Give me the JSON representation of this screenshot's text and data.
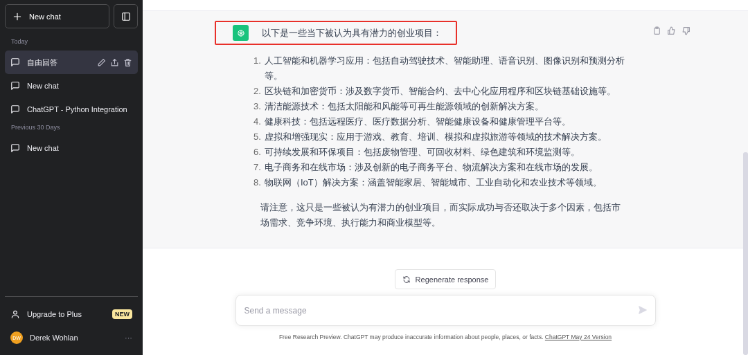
{
  "sidebar": {
    "new_chat": "New chat",
    "sections": [
      {
        "heading": "Today",
        "items": [
          {
            "title": "自由回答",
            "selected": true
          },
          {
            "title": "New chat",
            "selected": false
          },
          {
            "title": "ChatGPT - Python Integration",
            "selected": false
          }
        ]
      },
      {
        "heading": "Previous 30 Days",
        "items": [
          {
            "title": "New chat",
            "selected": false
          }
        ]
      }
    ],
    "upgrade": {
      "label": "Upgrade to Plus",
      "badge": "NEW"
    },
    "user": {
      "initials": "DW",
      "name": "Derek Wohlan",
      "menu": "···"
    }
  },
  "message": {
    "highlighted": true,
    "intro": "以下是一些当下被认为具有潜力的创业项目：",
    "list": [
      {
        "number": "1.",
        "text": "人工智能和机器学习应用：包括自动驾驶技术、智能助理、语音识别、图像识别和预测分析等。"
      },
      {
        "number": "2.",
        "text": "区块链和加密货币：涉及数字货币、智能合约、去中心化应用程序和区块链基础设施等。"
      },
      {
        "number": "3.",
        "text": "清洁能源技术：包括太阳能和风能等可再生能源领域的创新解决方案。"
      },
      {
        "number": "4.",
        "text": "健康科技：包括远程医疗、医疗数据分析、智能健康设备和健康管理平台等。"
      },
      {
        "number": "5.",
        "text": "虚拟和增强现实：应用于游戏、教育、培训、模拟和虚拟旅游等领域的技术解决方案。"
      },
      {
        "number": "6.",
        "text": "可持续发展和环保项目：包括废物管理、可回收材料、绿色建筑和环境监测等。"
      },
      {
        "number": "7.",
        "text": "电子商务和在线市场：涉及创新的电子商务平台、物流解决方案和在线市场的发展。"
      },
      {
        "number": "8.",
        "text": "物联网（IoT）解决方案：涵盖智能家居、智能城市、工业自动化和农业技术等领域。"
      }
    ],
    "closing": "请注意，这只是一些被认为有潜力的创业项目，而实际成功与否还取决于多个因素，包括市场需求、竞争环境、执行能力和商业模型等。"
  },
  "regenerate": "Regenerate response",
  "composer": {
    "placeholder": "Send a message"
  },
  "footer": {
    "text": "Free Research Preview. ChatGPT may produce inaccurate information about people, places, or facts.",
    "link": "ChatGPT May 24 Version"
  }
}
